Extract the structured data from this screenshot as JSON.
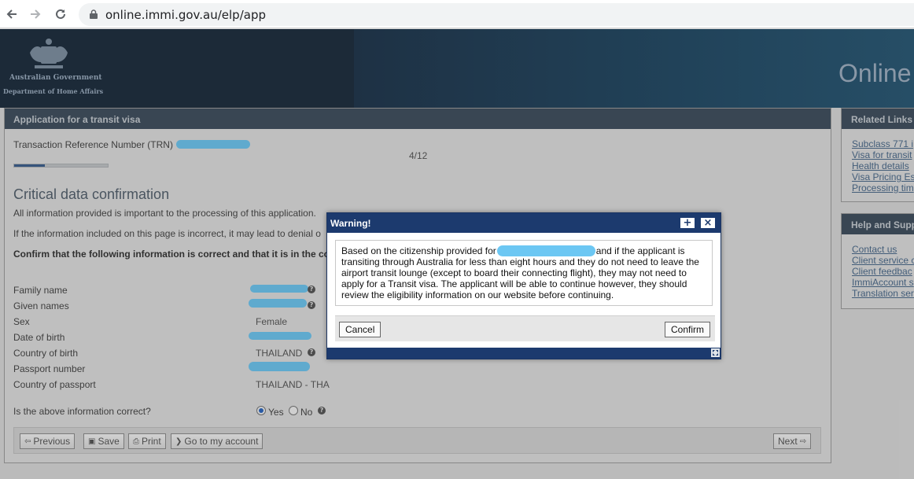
{
  "browser": {
    "url": "online.immi.gov.au/elp/app"
  },
  "header": {
    "gov_name": "Australian Government",
    "dept_name": "Department of Home Affairs",
    "title": "Online"
  },
  "main": {
    "panel_title": "Application for a transit visa",
    "trn_label": "Transaction Reference Number (TRN)",
    "progress": {
      "text": "4/12",
      "fraction": 0.33
    },
    "section_title": "Critical data confirmation",
    "info_1": "All information provided is important to the processing of this application.",
    "info_2": "If the information included on this page is incorrect, it may lead to denial o",
    "info_3": "Confirm that the following information is correct and that it is in the co",
    "fields": [
      {
        "label": "Family name",
        "value": ""
      },
      {
        "label": "Given names",
        "value": ""
      },
      {
        "label": "Sex",
        "value": "Female"
      },
      {
        "label": "Date of birth",
        "value": ""
      },
      {
        "label": "Country of birth",
        "value": "THAILAND"
      },
      {
        "label": "Passport number",
        "value": ""
      },
      {
        "label": "Country of passport",
        "value": "THAILAND - THA"
      }
    ],
    "question": "Is the above information correct?",
    "yes_label": "Yes",
    "no_label": "No",
    "buttons": {
      "previous": "Previous",
      "save": "Save",
      "print": "Print",
      "account": "Go to my account",
      "next": "Next"
    }
  },
  "related_links": {
    "title": "Related Links",
    "items": [
      "Subclass 771 i",
      "Visa for transit",
      "Health details",
      "Visa Pricing Es",
      "Processing tim"
    ]
  },
  "help_support": {
    "title": "Help and Supp",
    "items": [
      "Contact us",
      "Client service c",
      "Client feedbac",
      "ImmiAccount s",
      "Translation ser"
    ]
  },
  "modal": {
    "title": "Warning!",
    "body_1": "Based on the citizenship provided for",
    "body_2": "and if the applicant is transiting through Australia for less than eight hours and they do not need to leave the airport transit lounge (except to board their connecting flight), they may not need to apply for a Transit visa. The applicant will be able to continue however, they should review the eligibility information on our website before continuing.",
    "cancel": "Cancel",
    "confirm": "Confirm"
  },
  "colors": {
    "modal_header": "#1c3a6e",
    "panel_header": "#3e4e5d",
    "redaction": "#6cc7f3",
    "progress_fill": "#3a5f8f"
  }
}
